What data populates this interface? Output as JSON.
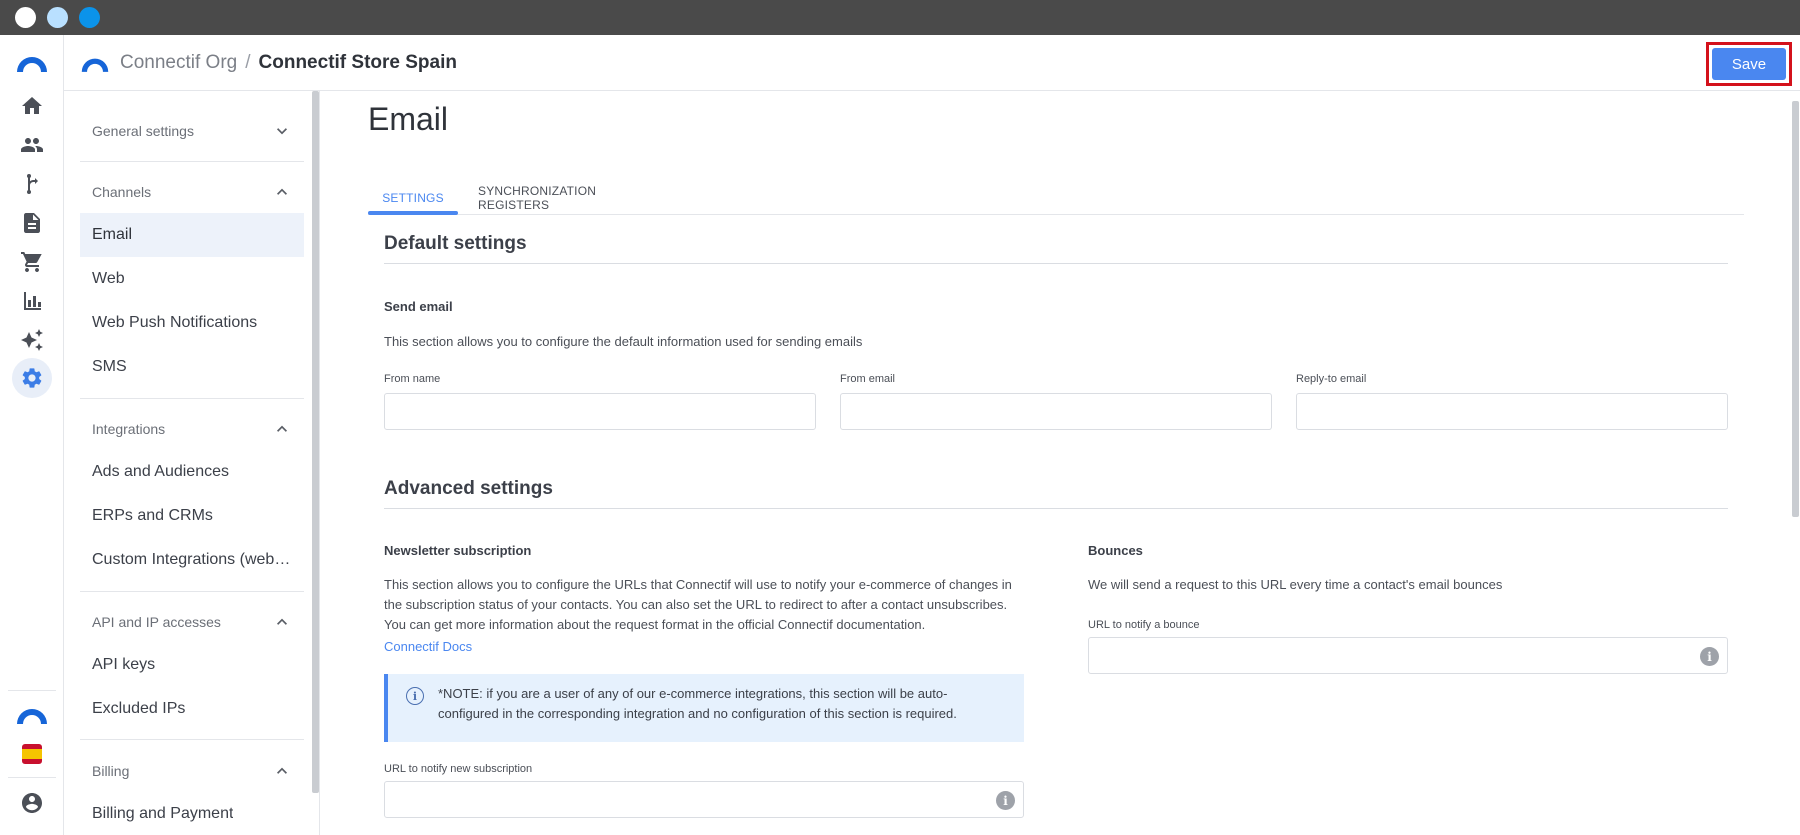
{
  "header": {
    "org": "Connectif Org",
    "separator": "/",
    "store": "Connectif Store Spain",
    "save_label": "Save"
  },
  "rail": {
    "icons": [
      "home-icon",
      "people-icon",
      "workflow-icon",
      "document-icon",
      "cart-icon",
      "chart-icon",
      "sparkle-icon",
      "gear-icon"
    ],
    "active": "gear-icon"
  },
  "sidebar": {
    "general": {
      "label": "General settings"
    },
    "channels": {
      "label": "Channels",
      "items": [
        "Email",
        "Web",
        "Web Push Notifications",
        "SMS"
      ]
    },
    "integrations": {
      "label": "Integrations",
      "items": [
        "Ads and Audiences",
        "ERPs and CRMs",
        "Custom Integrations (webh…"
      ]
    },
    "api": {
      "label": "API and IP accesses",
      "items": [
        "API keys",
        "Excluded IPs"
      ]
    },
    "billing": {
      "label": "Billing",
      "items": [
        "Billing and Payment"
      ]
    },
    "active_item": "Email"
  },
  "main": {
    "title": "Email",
    "tabs": [
      "SETTINGS",
      "SYNCHRONIZATION REGISTERS"
    ],
    "active_tab": "SETTINGS",
    "default_settings": {
      "title": "Default settings",
      "send_email_title": "Send email",
      "send_email_desc": "This section allows you to configure the default information used for sending emails",
      "from_name_label": "From name",
      "from_name_value": "",
      "from_email_label": "From email",
      "from_email_value": "",
      "reply_to_label": "Reply-to email",
      "reply_to_value": ""
    },
    "advanced_settings": {
      "title": "Advanced settings",
      "newsletter_title": "Newsletter subscription",
      "newsletter_desc": "This section allows you to configure the URLs that Connectif will use to notify your e-commerce of changes in the subscription status of your contacts. You can also set the URL to redirect to after a contact unsubscribes. You can get more information about the request format in the official Connectif documentation.",
      "docs_link": "Connectif Docs",
      "note": "*NOTE: if you are a user of any of our e-commerce integrations, this section will be auto-configured in the corresponding integration and no configuration of this section is required.",
      "new_subscription_label": "URL to notify new subscription",
      "new_subscription_value": "",
      "bounces_title": "Bounces",
      "bounces_desc": "We will send a request to this URL every time a contact's email bounces",
      "bounce_url_label": "URL to notify a bounce",
      "bounce_url_value": ""
    }
  },
  "colors": {
    "accent": "#4a87f0",
    "highlight_border": "#d4111b",
    "note_bg": "#e6f1fd"
  }
}
